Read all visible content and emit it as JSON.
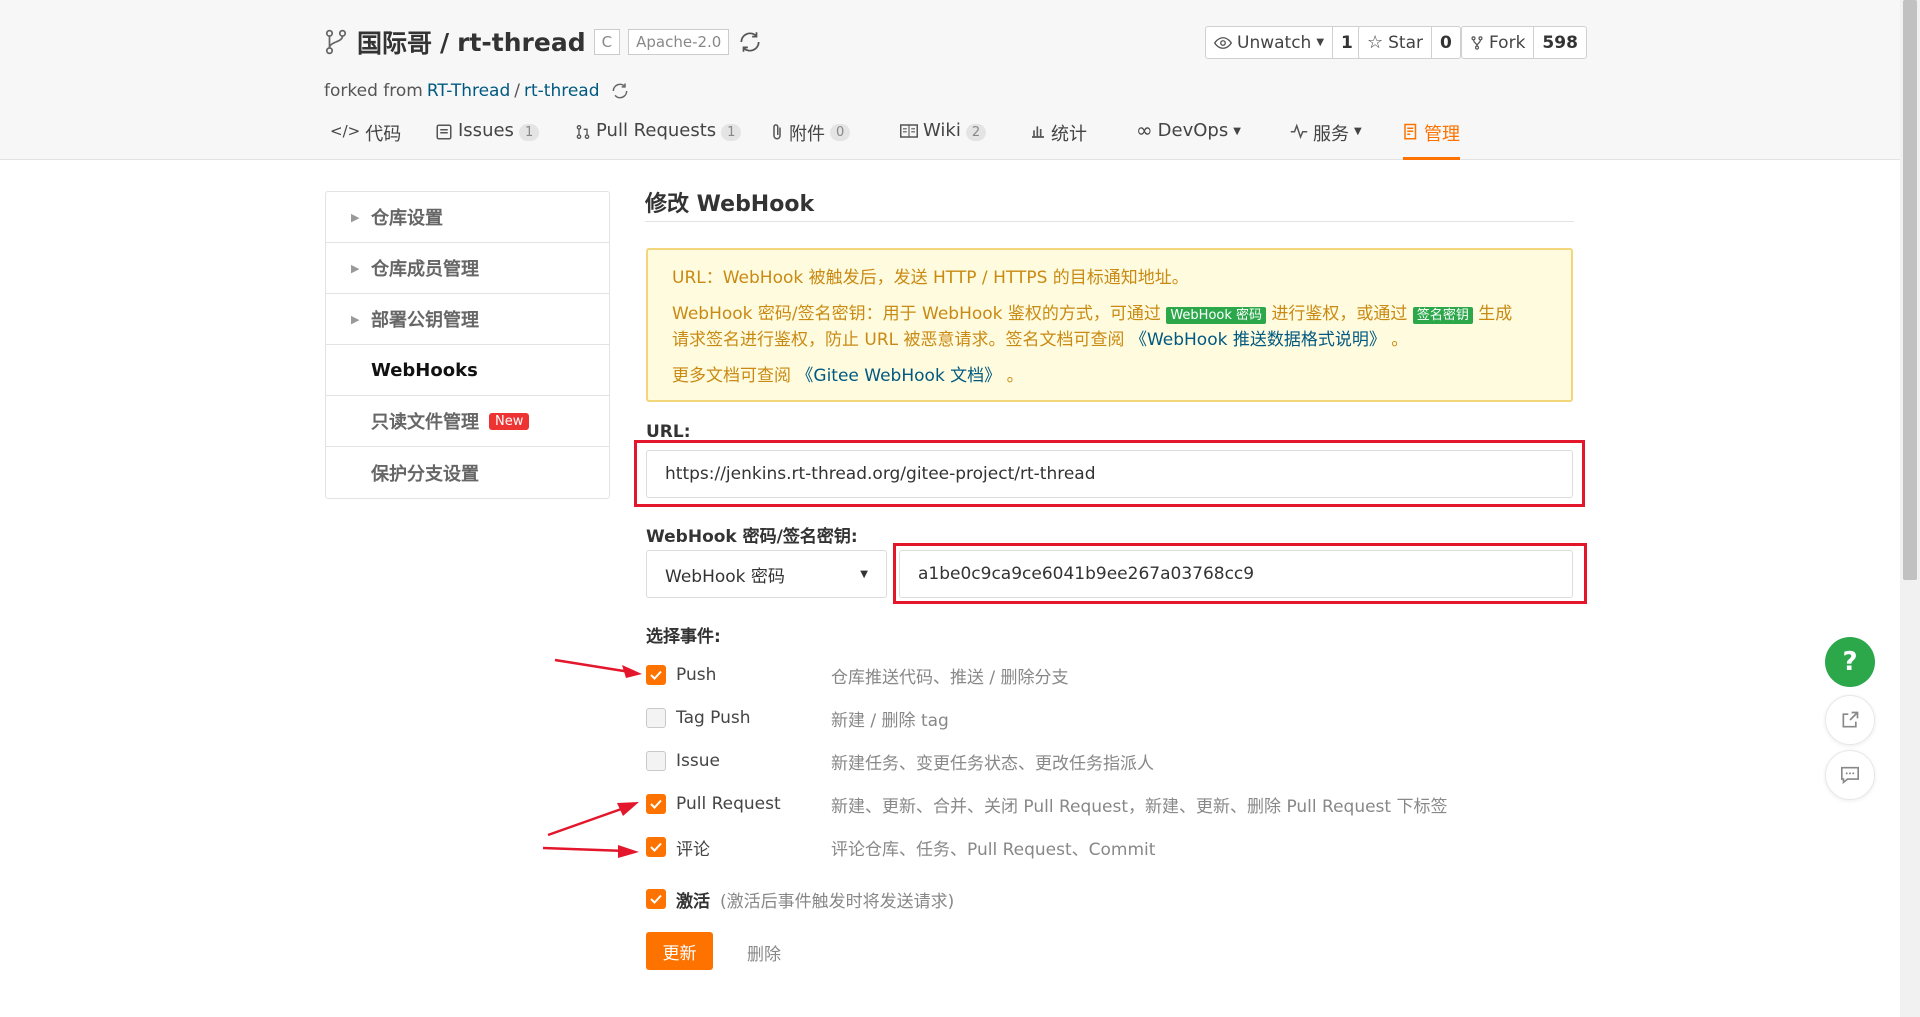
{
  "repo": {
    "owner": "国际哥",
    "separator": "/",
    "name": "rt-thread",
    "lang_badge": "C",
    "license_badge": "Apache-2.0",
    "forked_prefix": "forked from",
    "forked_owner": "RT-Thread",
    "forked_sep": "/",
    "forked_repo": "rt-thread"
  },
  "actions": {
    "unwatch_label": "Unwatch",
    "unwatch_count": "1",
    "star_label": "Star",
    "star_count": "0",
    "fork_label": "Fork",
    "fork_count": "598"
  },
  "tabs": [
    {
      "label": "代码",
      "count": ""
    },
    {
      "label": "Issues",
      "count": "1"
    },
    {
      "label": "Pull Requests",
      "count": "1"
    },
    {
      "label": "附件",
      "count": "0"
    },
    {
      "label": "Wiki",
      "count": "2"
    },
    {
      "label": "统计",
      "count": ""
    },
    {
      "label": "DevOps",
      "count": ""
    },
    {
      "label": "服务",
      "count": ""
    },
    {
      "label": "管理",
      "count": ""
    }
  ],
  "sidebar": {
    "items": [
      {
        "label": "仓库设置"
      },
      {
        "label": "仓库成员管理"
      },
      {
        "label": "部署公钥管理"
      },
      {
        "label": "WebHooks"
      },
      {
        "label": "只读文件管理",
        "badge": "New"
      },
      {
        "label": "保护分支设置"
      }
    ]
  },
  "form": {
    "title": "修改 WebHook",
    "notice": {
      "line1": "URL：WebHook 被触发后，发送 HTTP / HTTPS 的目标通知地址。",
      "line2_a": "WebHook 密码/签名密钥：用于 WebHook 鉴权的方式，可通过",
      "tag1": "WebHook 密码",
      "line2_b": "进行鉴权，或通过",
      "tag2": "签名密钥",
      "line2_c": "生成",
      "line3_a": "请求签名进行鉴权，防止 URL 被恶意请求。签名文档可查阅",
      "link1": "《WebHook 推送数据格式说明》",
      "line3_b": "。",
      "line4_a": "更多文档可查阅",
      "link2": "《Gitee WebHook 文档》",
      "line4_b": "。"
    },
    "url_label": "URL:",
    "url_value": "https://jenkins.rt-thread.org/gitee-project/rt-thread",
    "secret_label": "WebHook 密码/签名密钥:",
    "secret_type": "WebHook 密码",
    "secret_value": "a1be0c9ca9ce6041b9ee267a03768cc9",
    "events_label": "选择事件:",
    "events": [
      {
        "name": "Push",
        "desc": "仓库推送代码、推送 / 删除分支",
        "checked": true
      },
      {
        "name": "Tag Push",
        "desc": "新建 / 删除 tag",
        "checked": false
      },
      {
        "name": "Issue",
        "desc": "新建任务、变更任务状态、更改任务指派人",
        "checked": false
      },
      {
        "name": "Pull Request",
        "desc": "新建、更新、合并、关闭 Pull Request，新建、更新、删除 Pull Request 下标签",
        "checked": true
      },
      {
        "name": "评论",
        "desc": "评论仓库、任务、Pull Request、Commit",
        "checked": true
      }
    ],
    "activate_label": "激活",
    "activate_hint": "(激活后事件触发时将发送请求)",
    "update_button": "更新",
    "delete_button": "删除"
  },
  "floating": {
    "help_label": "?"
  },
  "colors": {
    "accent": "#fe7300",
    "highlight_red": "#e3162b",
    "success_green": "#2ca84b"
  }
}
